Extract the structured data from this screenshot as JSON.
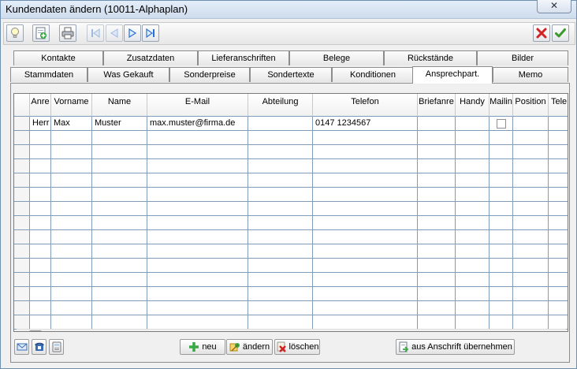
{
  "window": {
    "title": "Kundendaten ändern (10011-Alphaplan)",
    "close_glyph": "✕"
  },
  "toolbar": {
    "items": [
      {
        "name": "lightbulb-icon"
      },
      {
        "name": "new-record-icon"
      },
      {
        "name": "print-icon"
      },
      {
        "name": "first-record-icon"
      },
      {
        "name": "previous-record-icon"
      },
      {
        "name": "next-record-icon"
      },
      {
        "name": "last-record-icon"
      },
      {
        "name": "cancel-icon"
      },
      {
        "name": "confirm-icon"
      }
    ]
  },
  "tabs": {
    "row1": [
      "Kontakte",
      "Zusatzdaten",
      "Lieferanschriften",
      "Belege",
      "Rückstände",
      "Bilder"
    ],
    "row2": [
      "Stammdaten",
      "Was Gekauft",
      "Sonderpreise",
      "Sondertexte",
      "Konditionen",
      "Ansprechpart.",
      "Memo"
    ],
    "active": "Ansprechpart."
  },
  "grid": {
    "columns": [
      "Anre",
      "Vorname",
      "Name",
      "E-Mail",
      "Abteilung",
      "Telefon",
      "Briefanre",
      "Handy",
      "Mailin",
      "Position",
      "Tele"
    ],
    "rows": [
      [
        "Herr",
        "Max",
        "Muster",
        "max.muster@firma.de",
        "",
        "0147 1234567",
        "",
        "",
        "",
        "",
        ""
      ]
    ],
    "mailing_checked": false
  },
  "bottom": {
    "new_label": "neu",
    "edit_label": "ändern",
    "delete_label": "löschen",
    "copy_address_label": "aus Anschrift übernehmen"
  },
  "colors": {
    "accent_blue": "#2c6fd1",
    "cancel_red": "#d42020",
    "confirm_green": "#3a9b2a"
  }
}
